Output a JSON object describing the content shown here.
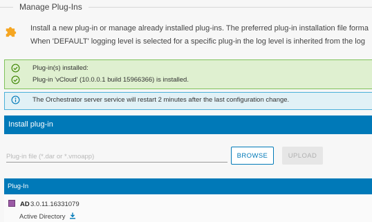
{
  "header": {
    "title": "Manage Plug-Ins",
    "description_line1": "Install a new plug-in or manage already installed plug-ins. The preferred plug-in installation file forma",
    "description_line2": "When 'DEFAULT' logging level is selected for a specific plug-in the log level is inherited from the log"
  },
  "alerts": {
    "success": {
      "line1": "Plug-in(s) installed:",
      "line2": "Plug-in 'vCloud' (10.0.0.1 build 15966366) is installed.",
      "icon": "check-circle-icon",
      "color": "#7fc25a"
    },
    "info": {
      "text": "The Orchestrator server service will restart 2 minutes after the last configuration change.",
      "icon": "info-circle-icon",
      "color": "#49afd9"
    }
  },
  "install": {
    "title": "Install plug-in",
    "file_placeholder": "Plug-in file (*.dar or *.vmoapp)",
    "file_value": "",
    "browse_label": "BROWSE",
    "upload_label": "UPLOAD",
    "accent": "#0079b8"
  },
  "plugins": {
    "column_header": "Plug-In",
    "items": [
      {
        "name": "AD",
        "version": "3.0.11.16331079",
        "description": "Active Directory",
        "icon": "plugin-package-icon"
      }
    ]
  },
  "icons": {
    "header_icon": "puzzle-piece-icon",
    "download_icon": "download-icon"
  }
}
